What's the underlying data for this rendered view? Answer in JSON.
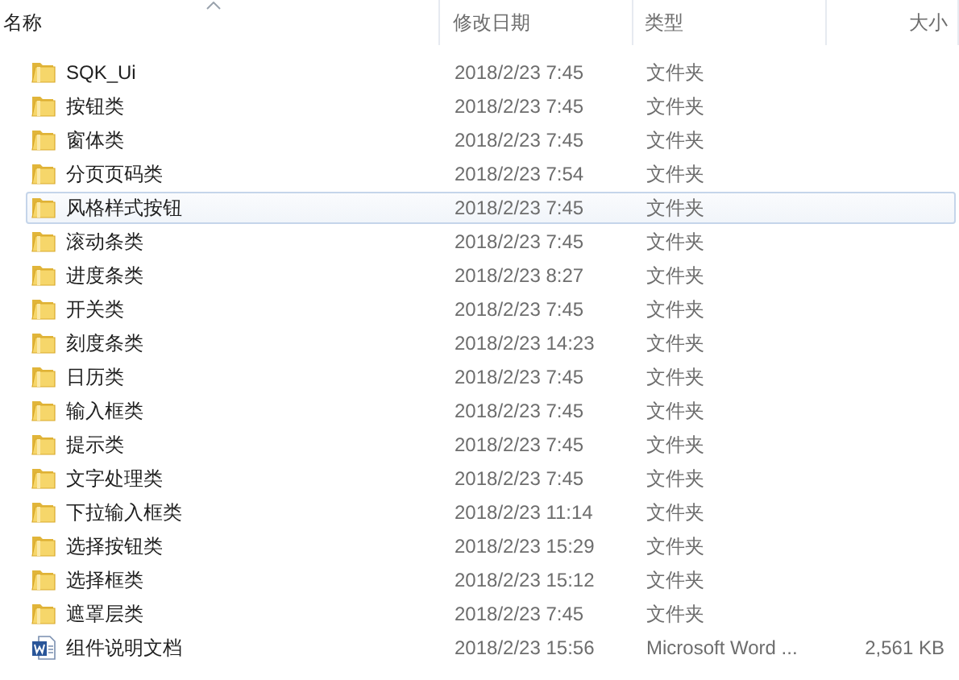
{
  "columns": [
    {
      "label": "名称",
      "sorted": true
    },
    {
      "label": "修改日期",
      "sorted": false
    },
    {
      "label": "类型",
      "sorted": false
    },
    {
      "label": "大小",
      "sorted": false
    }
  ],
  "files": [
    {
      "name": "SQK_Ui",
      "date": "2018/2/23 7:45",
      "type": "文件夹",
      "kind": "folder",
      "selected": false
    },
    {
      "name": "按钮类",
      "date": "2018/2/23 7:45",
      "type": "文件夹",
      "kind": "folder",
      "selected": false
    },
    {
      "name": "窗体类",
      "date": "2018/2/23 7:45",
      "type": "文件夹",
      "kind": "folder",
      "selected": false
    },
    {
      "name": "分页页码类",
      "date": "2018/2/23 7:54",
      "type": "文件夹",
      "kind": "folder",
      "selected": false
    },
    {
      "name": "风格样式按钮",
      "date": "2018/2/23 7:45",
      "type": "文件夹",
      "kind": "folder",
      "selected": true
    },
    {
      "name": "滚动条类",
      "date": "2018/2/23 7:45",
      "type": "文件夹",
      "kind": "folder",
      "selected": false
    },
    {
      "name": "进度条类",
      "date": "2018/2/23 8:27",
      "type": "文件夹",
      "kind": "folder",
      "selected": false
    },
    {
      "name": "开关类",
      "date": "2018/2/23 7:45",
      "type": "文件夹",
      "kind": "folder",
      "selected": false
    },
    {
      "name": "刻度条类",
      "date": "2018/2/23 14:23",
      "type": "文件夹",
      "kind": "folder",
      "selected": false
    },
    {
      "name": "日历类",
      "date": "2018/2/23 7:45",
      "type": "文件夹",
      "kind": "folder",
      "selected": false
    },
    {
      "name": "输入框类",
      "date": "2018/2/23 7:45",
      "type": "文件夹",
      "kind": "folder",
      "selected": false
    },
    {
      "name": "提示类",
      "date": "2018/2/23 7:45",
      "type": "文件夹",
      "kind": "folder",
      "selected": false
    },
    {
      "name": "文字处理类",
      "date": "2018/2/23 7:45",
      "type": "文件夹",
      "kind": "folder",
      "selected": false
    },
    {
      "name": "下拉输入框类",
      "date": "2018/2/23 11:14",
      "type": "文件夹",
      "kind": "folder",
      "selected": false
    },
    {
      "name": "选择按钮类",
      "date": "2018/2/23 15:29",
      "type": "文件夹",
      "kind": "folder",
      "selected": false
    },
    {
      "name": "选择框类",
      "date": "2018/2/23 15:12",
      "type": "文件夹",
      "kind": "folder",
      "selected": false
    },
    {
      "name": "遮罩层类",
      "date": "2018/2/23 7:45",
      "type": "文件夹",
      "kind": "folder",
      "selected": false
    },
    {
      "name": "组件说明文档",
      "date": "2018/2/23 15:56",
      "type": "Microsoft Word ...",
      "size": "2,561 KB",
      "kind": "word",
      "selected": false
    }
  ]
}
